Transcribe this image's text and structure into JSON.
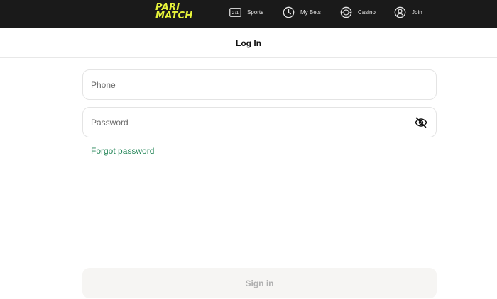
{
  "brand": {
    "logo_line1": "PARI",
    "logo_line2": "MATCH",
    "logo_color": "#e7f43a"
  },
  "nav": {
    "items": [
      {
        "label": "Sports",
        "icon": "scoreboard-icon"
      },
      {
        "label": "My Bets",
        "icon": "clock-icon"
      },
      {
        "label": "Casino",
        "icon": "casino-chip-icon"
      },
      {
        "label": "Join",
        "icon": "user-icon"
      }
    ],
    "sports_icon_text": "2:1"
  },
  "page": {
    "title": "Log In"
  },
  "form": {
    "phone_placeholder": "Phone",
    "password_placeholder": "Password",
    "forgot_label": "Forgot password",
    "signin_label": "Sign in"
  },
  "colors": {
    "topbar_bg": "#1a1a1a",
    "link_green": "#27875a",
    "button_bg": "#f6f5f3"
  }
}
